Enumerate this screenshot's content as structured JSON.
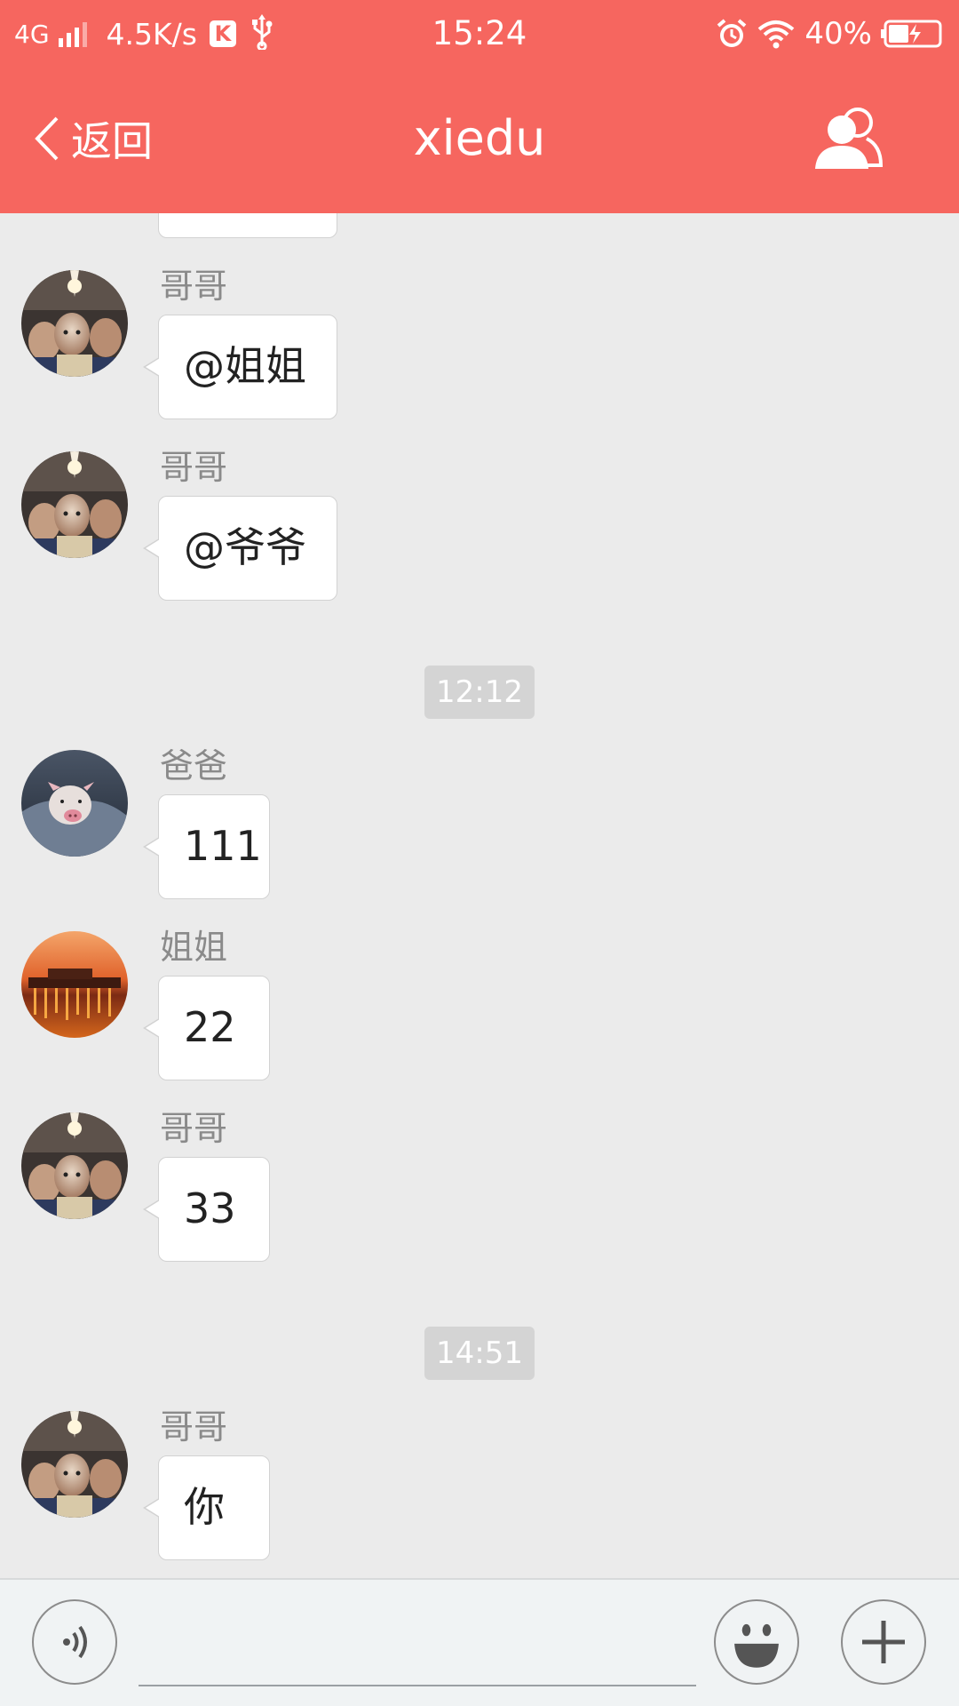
{
  "status_bar": {
    "network": "4G",
    "speed": "4.5K/s",
    "app_badge": "K",
    "time": "15:24",
    "battery_percent": "40%",
    "battery_level": 0.4,
    "icons": [
      "signal-icon",
      "usb-icon",
      "alarm-icon",
      "wifi-icon",
      "battery-icon"
    ]
  },
  "nav": {
    "back_label": "返回",
    "title": "xiedu",
    "members_icon": "group-members-icon"
  },
  "messages": [
    {
      "sender": "哥哥",
      "text": "@姐姐",
      "avatar": "avatar-gege"
    },
    {
      "sender": "哥哥",
      "text": "@爷爷",
      "avatar": "avatar-gege"
    },
    {
      "timestamp": "12:12"
    },
    {
      "sender": "爸爸",
      "text": "111",
      "avatar": "avatar-baba"
    },
    {
      "sender": "姐姐",
      "text": "22",
      "avatar": "avatar-jiejie"
    },
    {
      "sender": "哥哥",
      "text": "33",
      "avatar": "avatar-gege"
    },
    {
      "timestamp": "14:51"
    },
    {
      "sender": "哥哥",
      "text": "你",
      "avatar": "avatar-gege"
    }
  ],
  "toolbar": {
    "voice_icon": "voice-icon",
    "emoji_icon": "emoji-icon",
    "plus_icon": "plus-icon",
    "input_value": ""
  },
  "colors": {
    "header": "#f6665f",
    "chat_background": "#ebebeb",
    "bubble": "#ffffff",
    "timestamp_pill": "#d4d4d4",
    "toolbar": "#f0f3f4"
  }
}
